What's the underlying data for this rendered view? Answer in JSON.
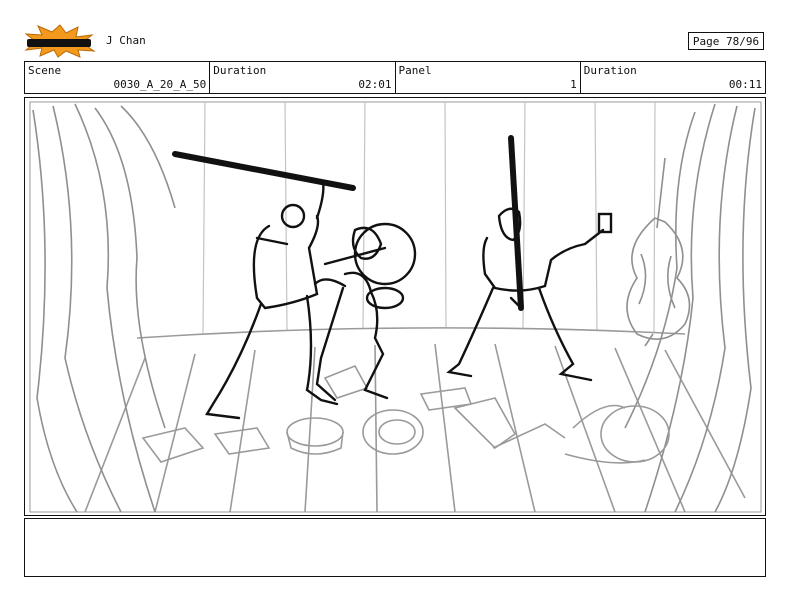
{
  "header": {
    "logo_text": "TOONBOOM",
    "project_title": "J Chan",
    "page_label": "Page 78/96"
  },
  "info": {
    "scene_label": "Scene",
    "scene_value": "0030_A_20_A_50",
    "duration_label": "Duration",
    "duration_value": "02:01",
    "panel_label": "Panel",
    "panel_value": "1",
    "panel_duration_label": "Duration",
    "panel_duration_value": "00:11"
  },
  "colors": {
    "logo_burst": "#f39a1e",
    "sketch_grey": "#9a9a9a",
    "ink": "#111111"
  }
}
